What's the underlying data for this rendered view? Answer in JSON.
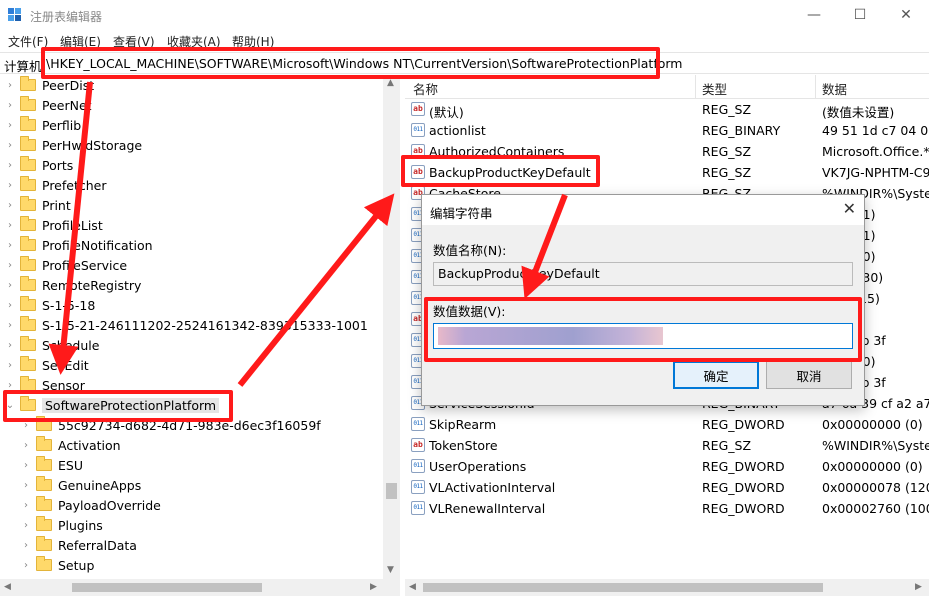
{
  "window": {
    "title": "注册表编辑器",
    "icon": "regedit-icon",
    "controls": [
      "minimize-icon",
      "maximize-icon",
      "close-icon"
    ]
  },
  "menu": [
    "文件(F)",
    "编辑(E)",
    "查看(V)",
    "收藏夹(A)",
    "帮助(H)"
  ],
  "address": {
    "label": "计算机",
    "path": "\\HKEY_LOCAL_MACHINE\\SOFTWARE\\Microsoft\\Windows NT\\CurrentVersion\\SoftwareProtectionPlatform"
  },
  "tree": [
    {
      "label": "PeerDist"
    },
    {
      "label": "PeerNet"
    },
    {
      "label": "Perflib"
    },
    {
      "label": "PerHwIdStorage"
    },
    {
      "label": "Ports"
    },
    {
      "label": "Prefetcher"
    },
    {
      "label": "Print"
    },
    {
      "label": "ProfileList"
    },
    {
      "label": "ProfileNotification"
    },
    {
      "label": "ProfileService"
    },
    {
      "label": "RemoteRegistry"
    },
    {
      "label": "S-1-5-18"
    },
    {
      "label": "S-1-5-21-246111202-2524161342-839315333-1001"
    },
    {
      "label": "Schedule"
    },
    {
      "label": "SecEdit"
    },
    {
      "label": "Sensor"
    },
    {
      "label": "SoftwareProtectionPlatform",
      "selected": true
    },
    {
      "label": "55c92734-d682-4d71-983e-d6ec3f16059f"
    },
    {
      "label": "Activation"
    },
    {
      "label": "ESU"
    },
    {
      "label": "GenuineApps"
    },
    {
      "label": "PayloadOverride"
    },
    {
      "label": "Plugins"
    },
    {
      "label": "ReferralData"
    },
    {
      "label": "Setup"
    }
  ],
  "list": {
    "headers": [
      "名称",
      "类型",
      "数据"
    ],
    "rows": [
      {
        "name": "(默认)",
        "type": "REG_SZ",
        "data": "(数值未设置)",
        "icon": "sz"
      },
      {
        "name": "actionlist",
        "type": "REG_BINARY",
        "data": "49 51 1d c7 04 00",
        "icon": "bin"
      },
      {
        "name": "AuthorizedContainers",
        "type": "REG_SZ",
        "data": "Microsoft.Office.*_",
        "icon": "sz"
      },
      {
        "name": "BackupProductKeyDefault",
        "type": "REG_SZ",
        "data": "VK7JG-NPHTM-C9",
        "icon": "sz"
      },
      {
        "name": "CacheStore",
        "type": "REG_SZ",
        "data": "%WINDIR%\\Syste",
        "icon": "sz"
      },
      {
        "name": "",
        "type": "",
        "data": "0001 (1)",
        "icon": "bin"
      },
      {
        "name": "",
        "type": "",
        "data": "0001 (1)",
        "icon": "bin"
      },
      {
        "name": "",
        "type": "",
        "data": "0000 (0)",
        "icon": "bin"
      },
      {
        "name": "",
        "type": "",
        "data": "001e (30)",
        "icon": "bin"
      },
      {
        "name": "",
        "type": "",
        "data": "000f (15)",
        "icon": "bin"
      },
      {
        "name": "",
        "type": "",
        "data": "",
        "icon": "sz"
      },
      {
        "name": "",
        "type": "",
        "data": "d 4a 2b 3f",
        "icon": "bin"
      },
      {
        "name": "",
        "type": "",
        "data": "0000 (0)",
        "icon": "bin"
      },
      {
        "name": "",
        "type": "",
        "data": "d 4a 2b 3f",
        "icon": "bin"
      },
      {
        "name": "ServiceSessionId",
        "type": "REG_BINARY",
        "data": "a7 6a 39 cf a2 a7",
        "icon": "bin"
      },
      {
        "name": "SkipRearm",
        "type": "REG_DWORD",
        "data": "0x00000000 (0)",
        "icon": "bin"
      },
      {
        "name": "TokenStore",
        "type": "REG_SZ",
        "data": "%WINDIR%\\Syste",
        "icon": "sz"
      },
      {
        "name": "UserOperations",
        "type": "REG_DWORD",
        "data": "0x00000000 (0)",
        "icon": "bin"
      },
      {
        "name": "VLActivationInterval",
        "type": "REG_DWORD",
        "data": "0x00000078 (120)",
        "icon": "bin"
      },
      {
        "name": "VLRenewalInterval",
        "type": "REG_DWORD",
        "data": "0x00002760 (1008",
        "icon": "bin"
      }
    ]
  },
  "dialog": {
    "title": "编辑字符串",
    "name_label": "数值名称(N):",
    "name_value": "BackupProductKeyDefault",
    "data_label": "数值数据(V):",
    "ok": "确定",
    "cancel": "取消"
  },
  "colors": {
    "highlight_red": "#ff1a1a",
    "accent_blue": "#0078d7",
    "folder_yellow": "#ffd96a",
    "redacted_pink": "#e8b9c9",
    "redacted_purple": "#a9a3cf"
  }
}
